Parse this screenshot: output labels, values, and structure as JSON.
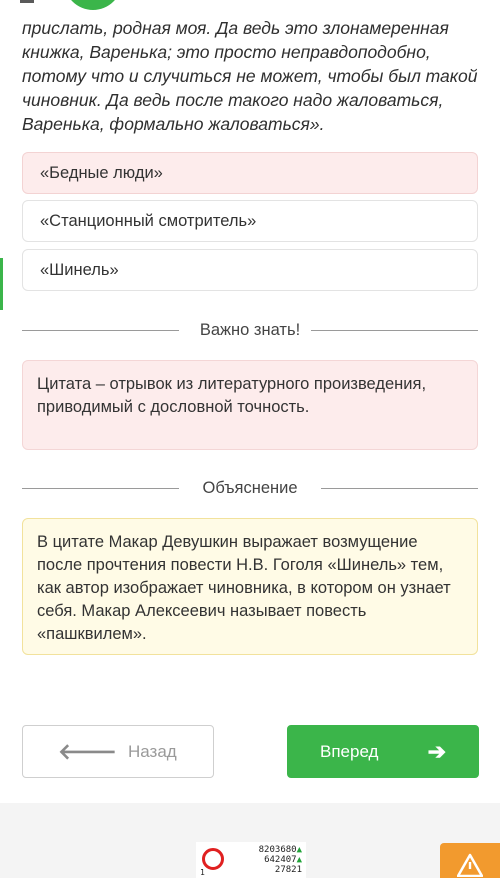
{
  "quote": {
    "text": "прислать, родная моя. Да ведь это злонамеренная\nкнижка, Варенька; это просто неправдоподобно,\nпотому что и случиться не может, чтобы был такой\nчиновник. Да ведь после такого надо жаловаться,\nВаренька, формально жаловаться»."
  },
  "options": [
    {
      "label": "«Бедные люди»",
      "state": "wrong"
    },
    {
      "label": "«Станционный смотритель»",
      "state": "neutral"
    },
    {
      "label": "«Шинель»",
      "state": "neutral"
    }
  ],
  "important": {
    "heading": "Важно знать!",
    "text": "Цитата – отрывок из литературного произведения, приводимый с дословной точность."
  },
  "explanation": {
    "heading": "Объяснение",
    "text": "В цитате Макар Девушкин выражает возмущение после прочтения повести Н.В. Гоголя «Шинель» тем, как автор изображает чиновника, в котором он узнает себя. Макар Алексеевич называет повесть «пашквилем»."
  },
  "nav": {
    "back_label": "Назад",
    "next_label": "Вперед",
    "back_icon": "arrow-left-icon",
    "next_icon": "arrow-right-icon"
  },
  "ad": {
    "counter_1": "8203680",
    "counter_2": "642407",
    "counter_3": "27821",
    "small": "1"
  },
  "colors": {
    "accent": "#3bb54a",
    "wrong_bg": "#fdecec",
    "explanation_bg": "#fffbe6",
    "warning": "#f29a2e"
  }
}
